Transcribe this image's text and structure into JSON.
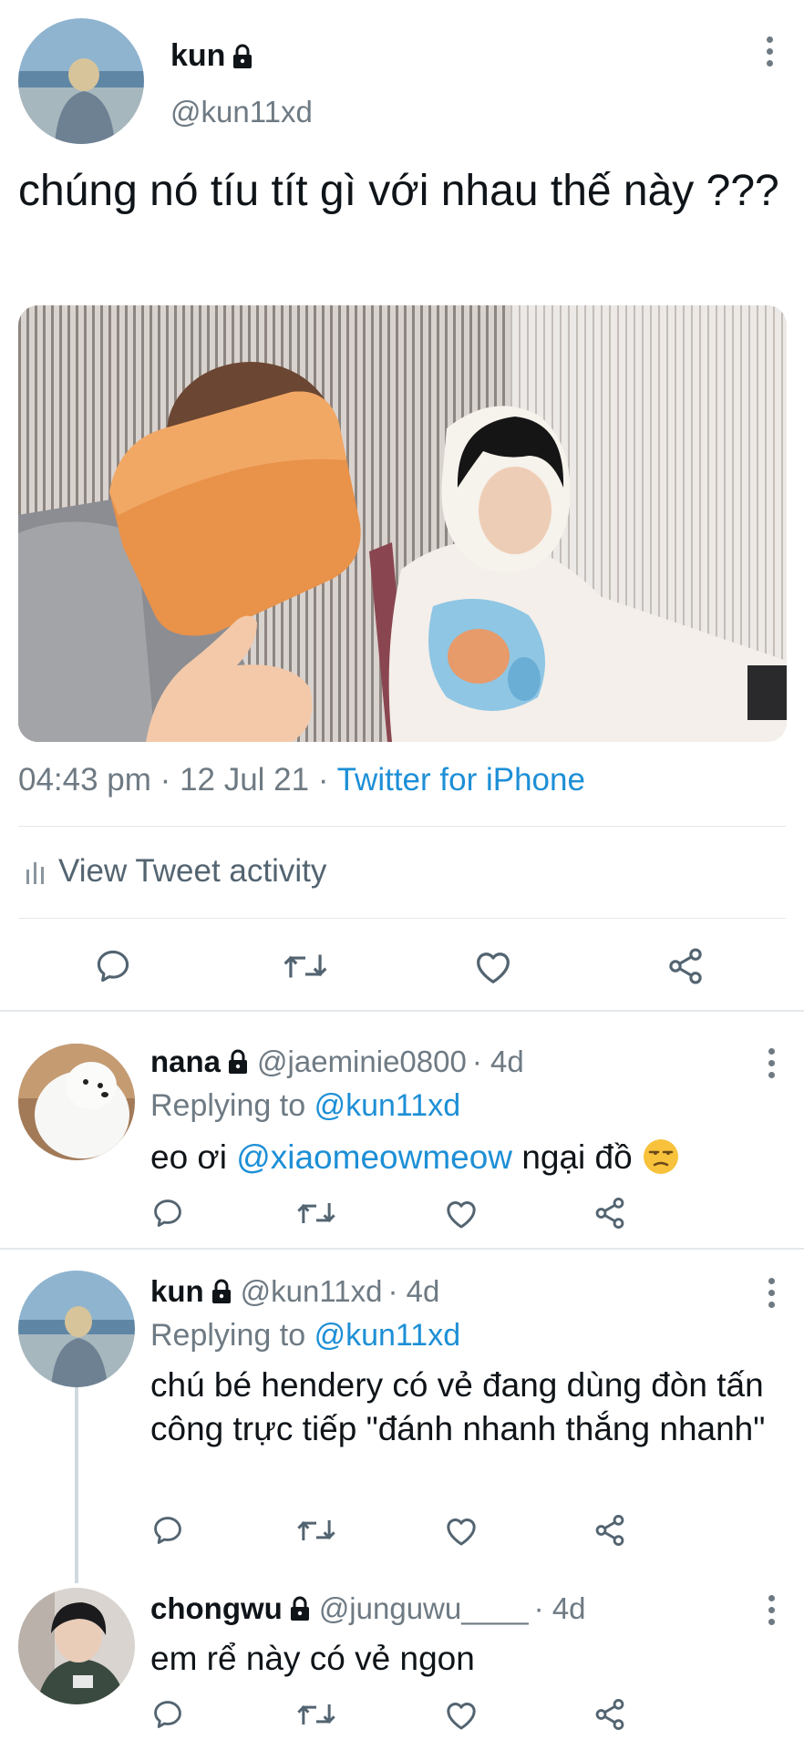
{
  "main_tweet": {
    "author_name": "kun",
    "handle": "@kun11xd",
    "text": "chúng nó tíu tít gì với nhau thế này ???",
    "time": "04:43 pm",
    "date": "12 Jul 21",
    "separator": "·",
    "source": "Twitter for iPhone",
    "activity_label": "View Tweet activity"
  },
  "replies": [
    {
      "name": "nana",
      "handle": "@jaeminie0800",
      "age": "· 4d",
      "replying_prefix": "Replying to",
      "replying_handle": "@kun11xd",
      "text_before": "eo ơi ",
      "mention": "@xiaomeowmeow",
      "text_after": " ngại đồ"
    },
    {
      "name": "kun",
      "handle": "@kun11xd",
      "age": "· 4d",
      "replying_prefix": "Replying to",
      "replying_handle": "@kun11xd",
      "text": "chú bé hendery có vẻ đang dùng đòn tấn công trực tiếp \"đánh nhanh thắng nhanh\""
    },
    {
      "name": "chongwu",
      "handle": "@junguwu____",
      "age": "· 4d",
      "text": "em rể này có vẻ ngon"
    }
  ],
  "colors": {
    "link": "#1d8fd6",
    "muted": "#6e7a83",
    "divider": "#e3e8ec",
    "text": "#0f1419"
  },
  "icons": [
    "lock-icon",
    "more-icon",
    "reply-icon",
    "retweet-icon",
    "like-icon",
    "share-icon",
    "analytics-icon",
    "unamused-emoji"
  ]
}
